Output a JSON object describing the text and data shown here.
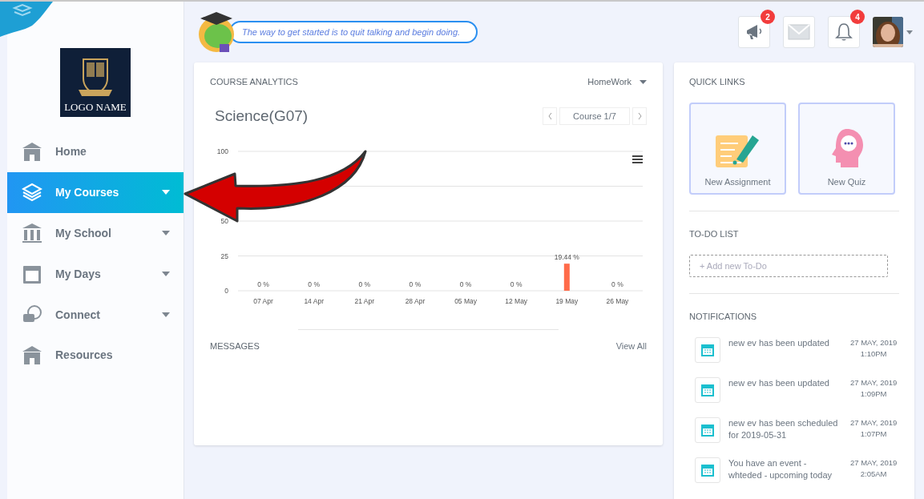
{
  "sidebar": {
    "logo_text": "LOGO NAME",
    "items": [
      {
        "label": "Home",
        "selected": false,
        "dropdown": false
      },
      {
        "label": "My Courses",
        "selected": true,
        "dropdown": true
      },
      {
        "label": "My School",
        "selected": false,
        "dropdown": true
      },
      {
        "label": "My Days",
        "selected": false,
        "dropdown": true
      },
      {
        "label": "Connect",
        "selected": false,
        "dropdown": true
      },
      {
        "label": "Resources",
        "selected": false,
        "dropdown": false
      }
    ]
  },
  "header": {
    "quote": "The way to get started is to quit talking and begin doing.",
    "announcements_badge": "2",
    "notifications_badge": "4"
  },
  "course_analytics": {
    "title": "COURSE ANALYTICS",
    "filter": "HomeWork",
    "course_name": "Science(G07)",
    "pager": "Course 1/7",
    "chart_data": {
      "type": "bar",
      "categories": [
        "07 Apr",
        "14 Apr",
        "21 Apr",
        "28 Apr",
        "05 May",
        "12 May",
        "19 May",
        "26 May"
      ],
      "series": [
        {
          "color": "#ff6b4a",
          "values": [
            0,
            0,
            0,
            0,
            0,
            0,
            19.44,
            0
          ]
        }
      ],
      "ylim": [
        0,
        100
      ],
      "yticks": [
        0,
        25,
        50,
        100
      ],
      "value_labels": [
        "0 %",
        "0 %",
        "0 %",
        "0 %",
        "0 %",
        "0 %",
        "19.44 %",
        "0 %"
      ]
    }
  },
  "messages": {
    "title": "MESSAGES",
    "link": "View All"
  },
  "quick_links": {
    "title": "QUICK LINKS",
    "items": [
      "New Assignment",
      "New Quiz"
    ]
  },
  "todo": {
    "title": "TO-DO LIST",
    "placeholder": "+ Add new To-Do"
  },
  "notifications": {
    "title": "NOTIFICATIONS",
    "items": [
      {
        "text": "new ev has been updated",
        "date": "27 MAY, 2019",
        "time": "1:10PM"
      },
      {
        "text": "new ev has been updated",
        "date": "27 MAY, 2019",
        "time": "1:09PM"
      },
      {
        "text": "new ev has been scheduled for 2019-05-31",
        "date": "27 MAY, 2019",
        "time": "1:07PM"
      },
      {
        "text": "You have an event - whteded - upcoming today",
        "date": "27 MAY, 2019",
        "time": "2:05AM"
      }
    ]
  }
}
